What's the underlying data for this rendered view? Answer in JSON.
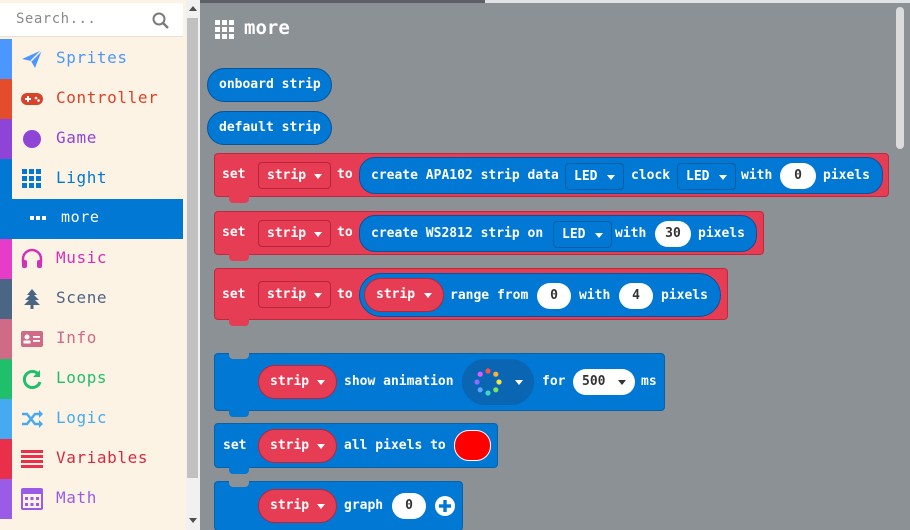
{
  "search": {
    "placeholder": "Search..."
  },
  "toolbox": {
    "categories": [
      {
        "label": "Sprites",
        "color": "#4c97ff",
        "icon": "paper-plane-icon"
      },
      {
        "label": "Controller",
        "color": "#d65cd6",
        "icon": "gamepad-icon"
      },
      {
        "label": "Game",
        "color": "#8f6cd6",
        "icon": "circle-icon"
      },
      {
        "label": "Light",
        "color": "#0078d4",
        "icon": "grid-icon"
      },
      {
        "label": "more",
        "color": "#0078d4",
        "icon": "ellipsis-icon"
      },
      {
        "label": "Music",
        "color": "#e63cc9",
        "icon": "headphones-icon"
      },
      {
        "label": "Scene",
        "color": "#4b6584",
        "icon": "tree-icon"
      },
      {
        "label": "Info",
        "color": "#cf6a87",
        "icon": "id-card-icon"
      },
      {
        "label": "Loops",
        "color": "#20bf6b",
        "icon": "refresh-icon"
      },
      {
        "label": "Logic",
        "color": "#45aaf2",
        "icon": "shuffle-icon"
      },
      {
        "label": "Variables",
        "color": "#ea2f4a",
        "icon": "list-icon"
      },
      {
        "label": "Math",
        "color": "#9a5ce6",
        "icon": "calculator-icon"
      }
    ]
  },
  "flyout": {
    "title": "more",
    "blocks": {
      "onboard": "onboard strip",
      "default": "default strip",
      "apa102": {
        "set": "set",
        "var": "strip",
        "to": "to",
        "text": "create APA102 strip data",
        "data_pin": "LED",
        "clock": "clock",
        "clock_pin": "LED",
        "with": "with",
        "pixels_value": "0",
        "pixels": "pixels"
      },
      "ws2812": {
        "set": "set",
        "var": "strip",
        "to": "to",
        "text": "create WS2812 strip on",
        "pin": "LED",
        "with": "with",
        "pixels_value": "30",
        "pixels": "pixels"
      },
      "range": {
        "set": "set",
        "var": "strip",
        "to": "to",
        "strip": "strip",
        "text": "range from",
        "from_value": "0",
        "with": "with",
        "count_value": "4",
        "pixels": "pixels"
      },
      "animation": {
        "strip": "strip",
        "text": "show animation",
        "for": "for",
        "duration": "500",
        "ms": "ms"
      },
      "allpixels": {
        "set": "set",
        "strip": "strip",
        "text": "all pixels to",
        "color": "#ff0000"
      },
      "graph": {
        "strip": "strip",
        "text": "graph",
        "value": "0"
      }
    }
  },
  "colors": {
    "light_block": "#0078d4",
    "variable_block": "#e63d54",
    "flyout_bg": "#8b9194",
    "toolbox_bg": "#fdf3e5"
  }
}
